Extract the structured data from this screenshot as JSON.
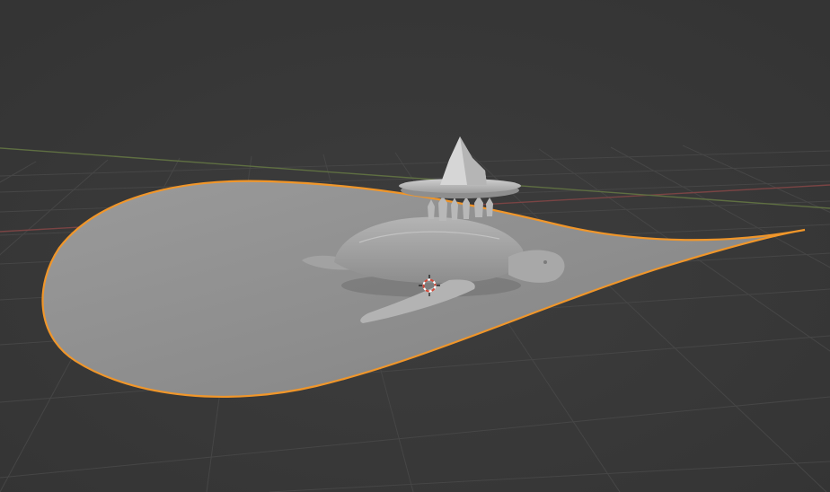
{
  "viewport": {
    "background": "#3a3a3a",
    "grid_color": "#464646",
    "x_axis_color": "#7a4444",
    "y_axis_color": "#5f6f42"
  },
  "selection": {
    "outline_color": "#f0962a",
    "selected_object": "plane"
  },
  "scene_objects": [
    {
      "name": "plane",
      "shape": "teardrop",
      "color": "#8e8e8e"
    },
    {
      "name": "turtle",
      "color": "#a9a9a9"
    },
    {
      "name": "disc-platform",
      "color": "#bdbdbd"
    },
    {
      "name": "iceberg",
      "color": "#cfcfcf"
    },
    {
      "name": "3d-cursor",
      "icon": "crosshair-icon"
    }
  ]
}
